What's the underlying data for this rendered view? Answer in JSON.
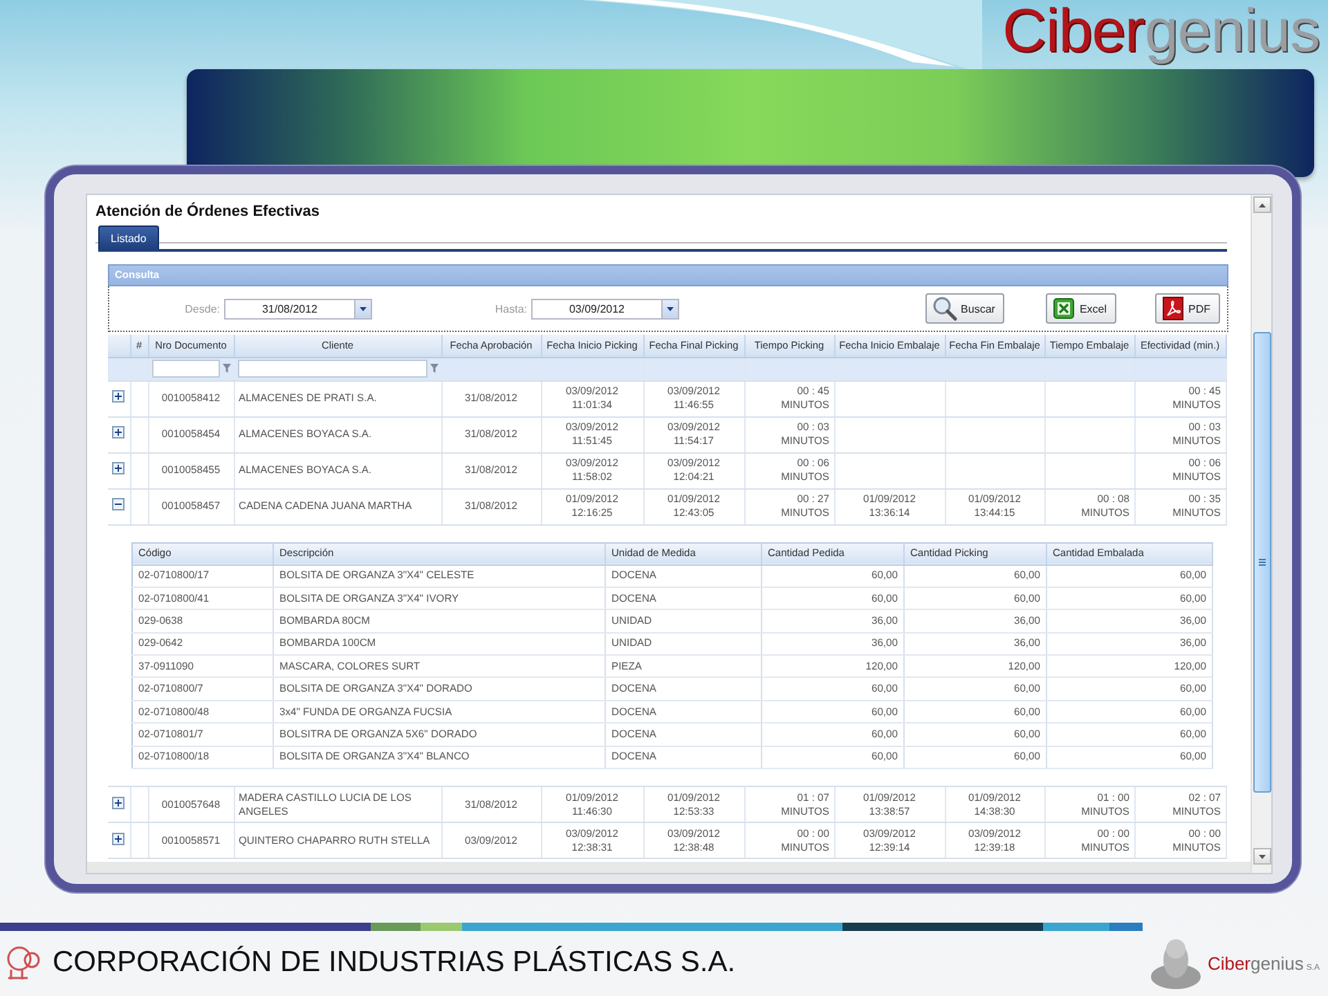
{
  "slide": {
    "logo": {
      "first": "Ciber",
      "second": "genius"
    }
  },
  "app": {
    "title": "Atención de Órdenes Efectivas",
    "tabs": [
      {
        "label": "Listado",
        "selected": true
      }
    ],
    "panel_title": "Consulta",
    "date_filters": [
      {
        "label": "Desde:",
        "value": "31/08/2012"
      },
      {
        "label": "Hasta:",
        "value": "03/09/2012"
      }
    ],
    "buttons": [
      {
        "label": "Buscar",
        "kind": "search"
      },
      {
        "label": "Excel",
        "kind": "excel"
      },
      {
        "label": "PDF",
        "kind": "pdf"
      }
    ],
    "grid": {
      "columns": [
        {
          "label": "#",
          "filter": false
        },
        {
          "label": "Nro Documento",
          "filter": true
        },
        {
          "label": "Cliente",
          "filter": true
        },
        {
          "label": "Fecha Aprobación",
          "filter": false
        },
        {
          "label": "Fecha Inicio Picking",
          "filter": false
        },
        {
          "label": "Fecha Final Picking",
          "filter": false
        },
        {
          "label": "Tiempo Picking",
          "filter": false
        },
        {
          "label": "Fecha Inicio Embalaje",
          "filter": false
        },
        {
          "label": "Fecha Fin Embalaje",
          "filter": false
        },
        {
          "label": "Tiempo Embalaje",
          "filter": false
        },
        {
          "label": "Efectividad (min.)",
          "filter": false
        }
      ],
      "rows": [
        {
          "expanded": false,
          "cells": [
            null,
            "0010058412",
            "ALMACENES DE PRATI S.A.",
            "31/08/2012",
            "03/09/2012\n11:01:34",
            "03/09/2012\n11:46:55",
            "00 : 45\nMINUTOS",
            null,
            null,
            null,
            "00 : 45\nMINUTOS"
          ]
        },
        {
          "expanded": false,
          "cells": [
            null,
            "0010058454",
            "ALMACENES BOYACA S.A.",
            "31/08/2012",
            "03/09/2012\n11:51:45",
            "03/09/2012\n11:54:17",
            "00 : 03\nMINUTOS",
            null,
            null,
            null,
            "00 : 03\nMINUTOS"
          ]
        },
        {
          "expanded": false,
          "cells": [
            null,
            "0010058455",
            "ALMACENES BOYACA S.A.",
            "31/08/2012",
            "03/09/2012\n11:58:02",
            "03/09/2012\n12:04:21",
            "00 : 06\nMINUTOS",
            null,
            null,
            null,
            "00 : 06\nMINUTOS"
          ]
        },
        {
          "expanded": true,
          "cells": [
            null,
            "0010058457",
            "CADENA CADENA JUANA MARTHA",
            "31/08/2012",
            "01/09/2012\n12:16:25",
            "01/09/2012\n12:43:05",
            "00 : 27\nMINUTOS",
            "01/09/2012\n13:36:14",
            "01/09/2012\n13:44:15",
            "00 : 08\nMINUTOS",
            "00 : 35\nMINUTOS"
          ],
          "details": {
            "columns": [
              "Código",
              "Descripción",
              "Unidad de Medida",
              "Cantidad Pedida",
              "Cantidad Picking",
              "Cantidad Embalada"
            ],
            "rows": [
              [
                "02-0710800/17",
                "BOLSITA DE ORGANZA 3\"X4\" CELESTE",
                "DOCENA",
                "60,00",
                "60,00",
                "60,00"
              ],
              [
                "02-0710800/41",
                "BOLSITA DE ORGANZA 3\"X4\" IVORY",
                "DOCENA",
                "60,00",
                "60,00",
                "60,00"
              ],
              [
                "029-0638",
                "BOMBARDA 80CM",
                "UNIDAD",
                "36,00",
                "36,00",
                "36,00"
              ],
              [
                "029-0642",
                "BOMBARDA 100CM",
                "UNIDAD",
                "36,00",
                "36,00",
                "36,00"
              ],
              [
                "37-0911090",
                "MASCARA, COLORES SURT",
                "PIEZA",
                "120,00",
                "120,00",
                "120,00"
              ],
              [
                "02-0710800/7",
                "BOLSITA DE ORGANZA 3\"X4\" DORADO",
                "DOCENA",
                "60,00",
                "60,00",
                "60,00"
              ],
              [
                "02-0710800/48",
                "3x4\" FUNDA DE ORGANZA FUCSIA",
                "DOCENA",
                "60,00",
                "60,00",
                "60,00"
              ],
              [
                "02-0710801/7",
                "BOLSITRA DE ORGANZA 5X6\" DORADO",
                "DOCENA",
                "60,00",
                "60,00",
                "60,00"
              ],
              [
                "02-0710800/18",
                "BOLSITA DE ORGANZA 3\"X4\" BLANCO",
                "DOCENA",
                "60,00",
                "60,00",
                "60,00"
              ]
            ]
          }
        },
        {
          "expanded": false,
          "cells": [
            null,
            "0010057648",
            "MADERA CASTILLO LUCIA DE LOS ANGELES",
            "31/08/2012",
            "01/09/2012\n11:46:30",
            "01/09/2012\n12:53:33",
            "01 : 07\nMINUTOS",
            "01/09/2012\n13:38:57",
            "01/09/2012\n14:38:30",
            "01 : 00\nMINUTOS",
            "02 : 07\nMINUTOS"
          ]
        },
        {
          "expanded": false,
          "cells": [
            null,
            "0010058571",
            "QUINTERO CHAPARRO RUTH STELLA",
            "03/09/2012",
            "03/09/2012\n12:38:31",
            "03/09/2012\n12:38:48",
            "00 : 00\nMINUTOS",
            "03/09/2012\n12:39:14",
            "03/09/2012\n12:39:18",
            "00 : 00\nMINUTOS",
            "00 : 00\nMINUTOS"
          ]
        }
      ]
    }
  },
  "footer": {
    "company": "CORPORACIÓN DE INDUSTRIAS PLÁSTICAS S.A.",
    "logo": {
      "first": "Ciber",
      "second": "genius",
      "suffix": "S.A"
    }
  }
}
